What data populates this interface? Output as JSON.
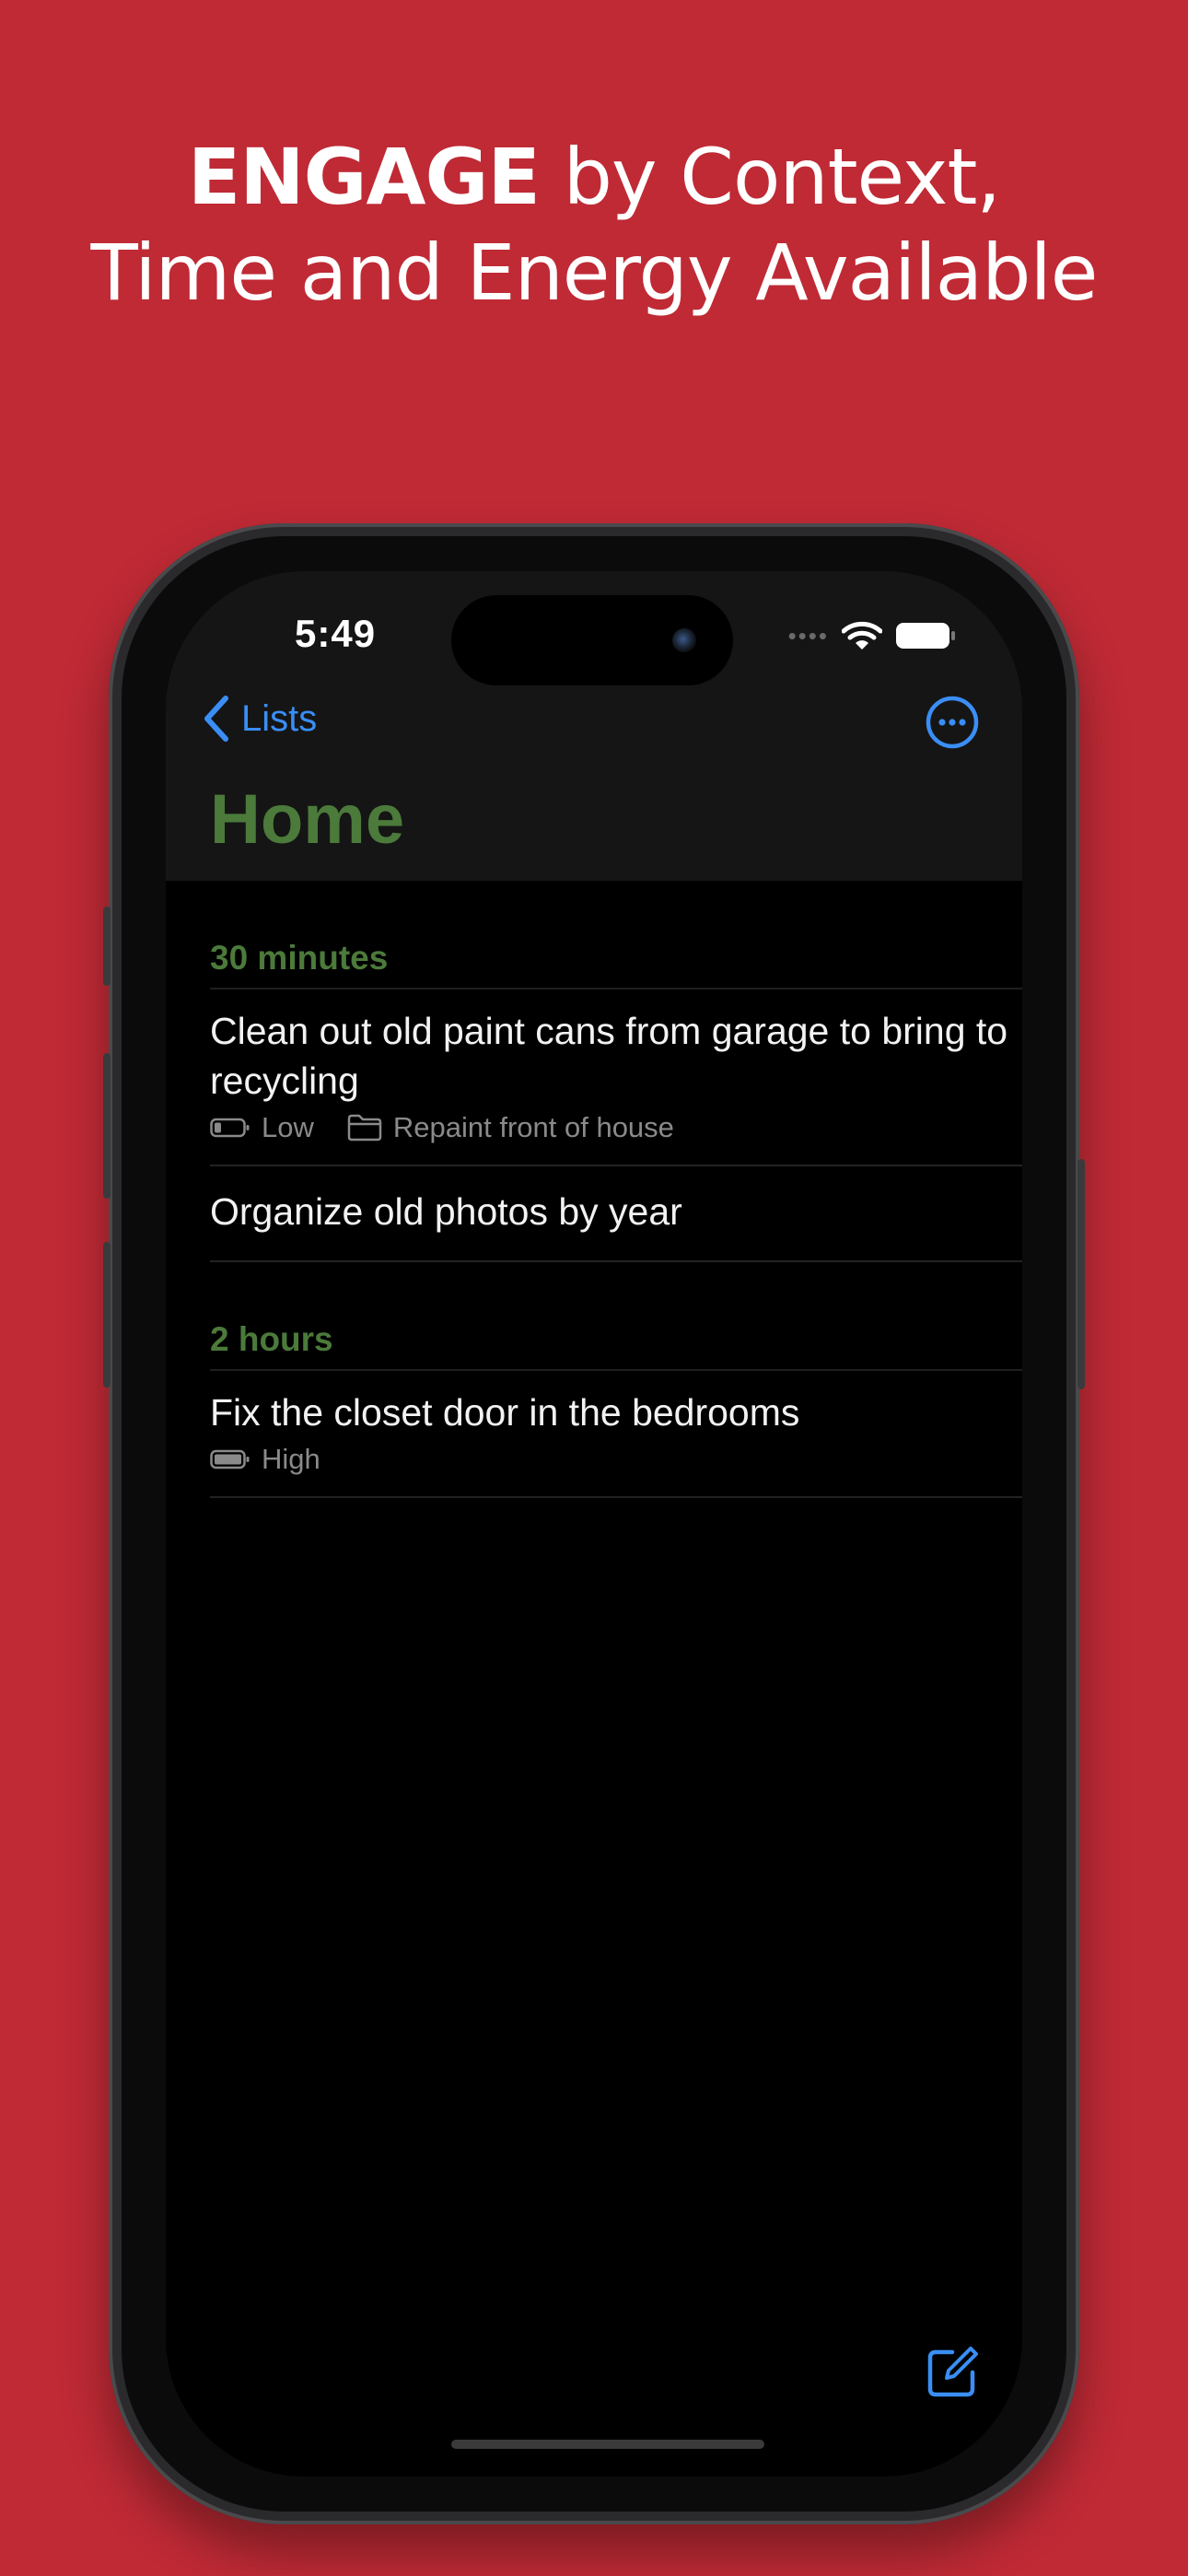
{
  "headline": {
    "bold": "ENGAGE",
    "line1_rest": " by Context,",
    "line2": "Time and Energy Available"
  },
  "status_bar": {
    "time": "5:49",
    "icons": [
      "signal-dots-icon",
      "wifi-icon",
      "battery-icon"
    ]
  },
  "nav": {
    "back_label": "Lists",
    "more_icon": "ellipsis-circle-icon",
    "title": "Home"
  },
  "sections": [
    {
      "header": "30 minutes",
      "items": [
        {
          "title": "Clean out old paint cans from garage to bring to recycling",
          "energy": "Low",
          "energy_icon": "battery-low-icon",
          "project": "Repaint front of house",
          "project_icon": "folder-icon"
        },
        {
          "title": "Organize old photos by year"
        }
      ]
    },
    {
      "header": "2 hours",
      "items": [
        {
          "title": "Fix the closet door in the bedrooms",
          "energy": "High",
          "energy_icon": "battery-full-icon"
        }
      ]
    }
  ],
  "toolbar": {
    "compose_icon": "compose-icon"
  },
  "colors": {
    "background": "#BF2A35",
    "accent": "#3A8EF5",
    "section": "#4B7A3A"
  }
}
